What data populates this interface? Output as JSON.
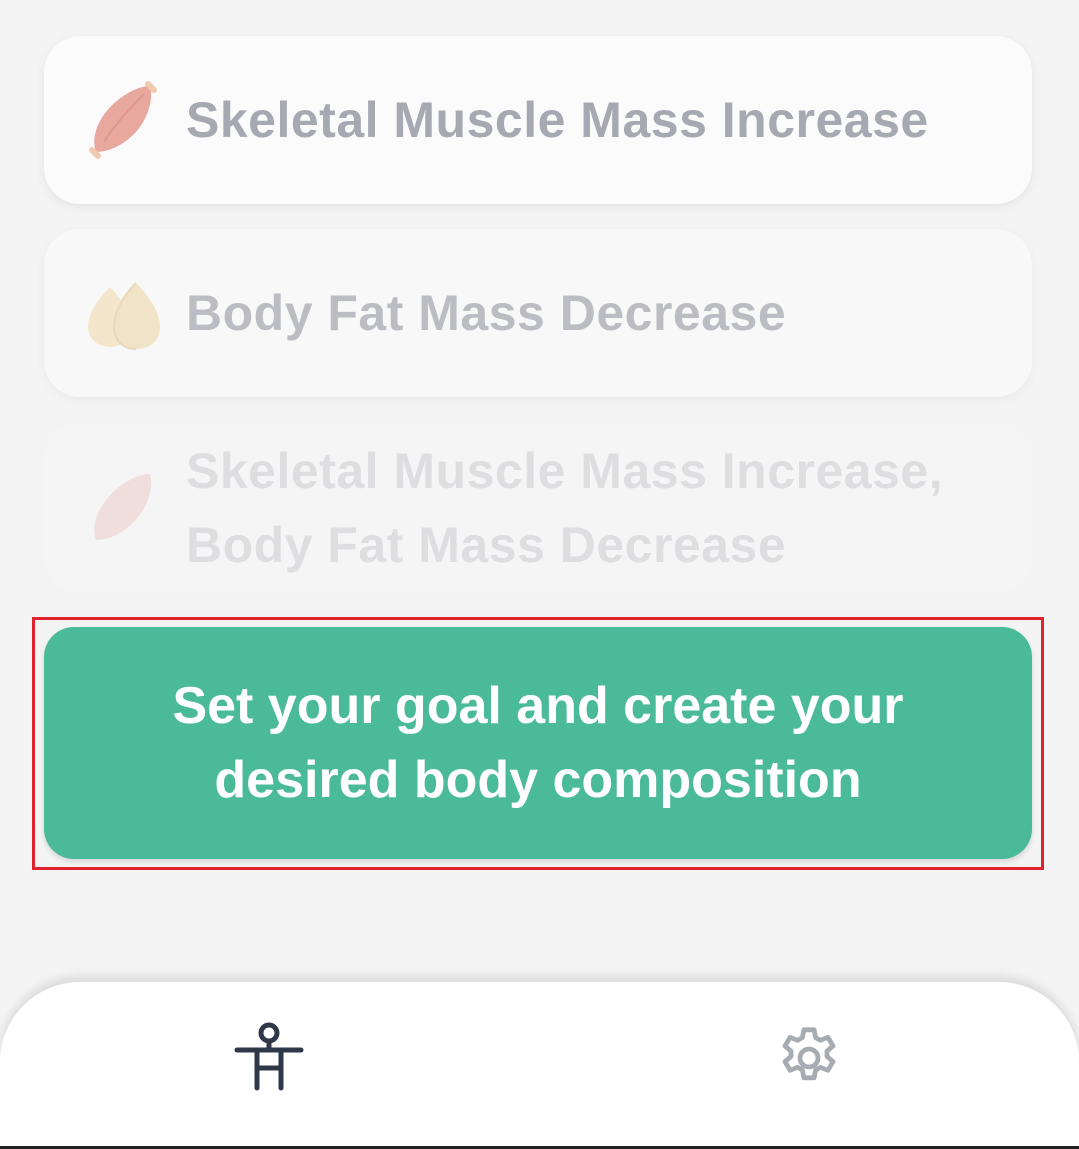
{
  "goals": [
    {
      "label": "Skeletal Muscle Mass Increase",
      "icon": "muscle-icon"
    },
    {
      "label": "Body Fat Mass Decrease",
      "icon": "fat-drop-icon"
    },
    {
      "label": "Skeletal Muscle Mass Increase, Body Fat Mass Decrease",
      "icon": "muscle-icon"
    }
  ],
  "cta": {
    "label": "Set your goal and create your desired body composition",
    "color": "#4aba98",
    "highlight_color": "#e0222d"
  },
  "bottom_nav": {
    "items": [
      {
        "icon": "body-figure-icon",
        "active": true
      },
      {
        "icon": "gear-icon",
        "active": false
      }
    ]
  },
  "colors": {
    "background": "#f4f4f5",
    "goal_text": "#a6a9b1",
    "muscle": "#e9a89d",
    "fat": "#f3e1bd",
    "nav_active": "#2e3848",
    "nav_inactive": "#a7abb2"
  }
}
